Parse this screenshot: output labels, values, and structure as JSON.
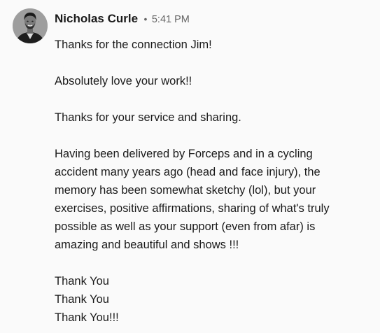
{
  "message": {
    "sender_name": "Nicholas Curle",
    "separator": "•",
    "timestamp": "5:41 PM",
    "avatar_icon": "person-avatar-photo",
    "paragraphs": [
      {
        "lines": [
          "Thanks for the connection Jim!"
        ]
      },
      {
        "lines": [
          "Absolutely love your work!!"
        ]
      },
      {
        "lines": [
          "Thanks for your service and sharing."
        ]
      },
      {
        "lines": [
          "Having been delivered by Forceps and in a cycling",
          "accident many years ago (head and face injury), the",
          "memory has been somewhat sketchy (lol), but your",
          "exercises, positive affirmations, sharing of what's truly",
          "possible as well as your support (even from afar) is",
          "amazing and beautiful and shows !!!"
        ]
      },
      {
        "lines": [
          "Thank You",
          "Thank You",
          "Thank You!!!"
        ]
      }
    ]
  }
}
